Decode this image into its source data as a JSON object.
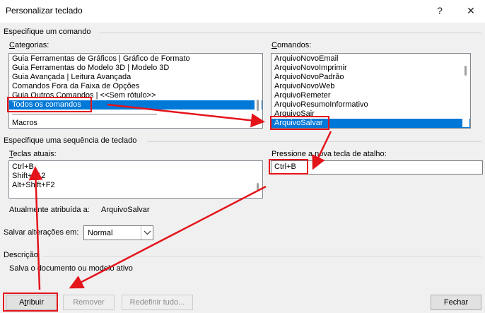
{
  "window": {
    "title": "Personalizar teclado",
    "help_glyph": "?",
    "close_glyph": "✕"
  },
  "command_section": {
    "label": "Especifique um comando",
    "categories_label": "Categorias:",
    "commands_label": "Comandos:",
    "categories": [
      "Guia Ferramentas de Gráficos | Gráfico de Formato",
      "Guia Ferramentas do Modelo 3D | Modelo 3D",
      "Guia Avançada | Leitura Avançada",
      "Comandos Fora da Faixa de Opções",
      "Guia Outros Comandos | <<Sem rótulo>>",
      "Todos os comandos",
      "",
      "Macros"
    ],
    "commands": [
      "ArquivoNovoEmail",
      "ArquivoNovoImprimir",
      "ArquivoNovoPadrão",
      "ArquivoNovoWeb",
      "ArquivoRemeter",
      "ArquivoResumoInformativo",
      "ArquivoSair",
      "ArquivoSalvar"
    ]
  },
  "shortcut_section": {
    "label": "Especifique uma sequência de teclado",
    "current_keys_label": "Teclas atuais:",
    "current_keys": [
      "Ctrl+B",
      "Shift+F12",
      "Alt+Shift+F2"
    ],
    "new_key_label": "Pressione a nova tecla de atalho:",
    "new_key_value": "Ctrl+B",
    "assigned_label": "Atualmente atribuída a:",
    "assigned_value": "ArquivoSalvar",
    "save_in_label": "Salvar alterações em:",
    "save_in_value": "Normal"
  },
  "description": {
    "label": "Descrição",
    "text": "Salva o documento ou modelo ativo"
  },
  "buttons": {
    "assign": "Atribuir",
    "remove": "Remover",
    "reset_all": "Redefinir tudo...",
    "close": "Fechar"
  },
  "colors": {
    "selection": "#0078d7",
    "annotation_red": "#e4141b"
  }
}
